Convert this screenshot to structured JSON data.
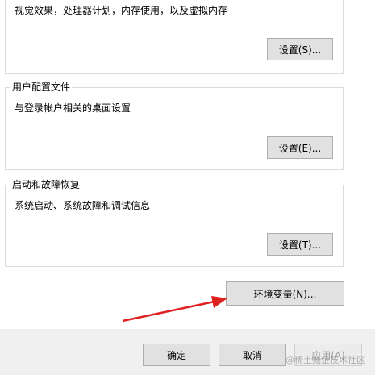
{
  "performance": {
    "description": "视觉效果，处理器计划，内存使用，以及虚拟内存",
    "settings_button": "设置(S)..."
  },
  "user_profiles": {
    "title": "用户配置文件",
    "description": "与登录帐户相关的桌面设置",
    "settings_button": "设置(E)..."
  },
  "startup_recovery": {
    "title": "启动和故障恢复",
    "description": "系统启动、系统故障和调试信息",
    "settings_button": "设置(T)..."
  },
  "env_vars_button": "环境变量(N)...",
  "footer": {
    "ok": "确定",
    "cancel": "取消",
    "apply": "应用(A)"
  },
  "watermark": "@稀土掘金技术社区",
  "colors": {
    "arrow": "#e02020",
    "footer_bg": "#f0f0f0"
  }
}
